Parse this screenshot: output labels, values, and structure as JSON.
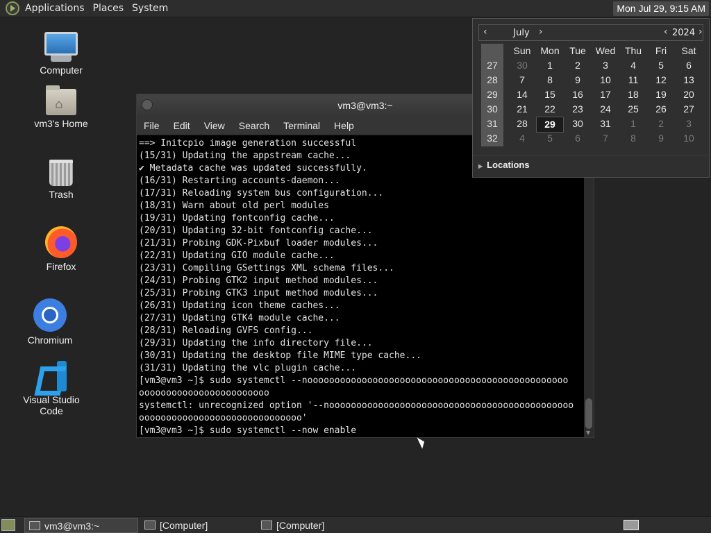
{
  "top_panel": {
    "menus": [
      "Applications",
      "Places",
      "System"
    ],
    "clock": "Mon Jul 29,  9:15 AM"
  },
  "desktop_icons": {
    "computer": "Computer",
    "home": "vm3's Home",
    "trash": "Trash",
    "firefox": "Firefox",
    "chromium": "Chromium",
    "vscode": "Visual Studio Code"
  },
  "terminal": {
    "title": "vm3@vm3:~",
    "menus": [
      "File",
      "Edit",
      "View",
      "Search",
      "Terminal",
      "Help"
    ],
    "lines": [
      "==> Initcpio image generation successful",
      "(15/31) Updating the appstream cache...",
      "✔ Metadata cache was updated successfully.",
      "(16/31) Restarting accounts-daemon...",
      "(17/31) Reloading system bus configuration...",
      "(18/31) Warn about old perl modules",
      "(19/31) Updating fontconfig cache...",
      "(20/31) Updating 32-bit fontconfig cache...",
      "(21/31) Probing GDK-Pixbuf loader modules...",
      "(22/31) Updating GIO module cache...",
      "(23/31) Compiling GSettings XML schema files...",
      "(24/31) Probing GTK2 input method modules...",
      "(25/31) Probing GTK3 input method modules...",
      "(26/31) Updating icon theme caches...",
      "(27/31) Updating GTK4 module cache...",
      "(28/31) Reloading GVFS config...",
      "(29/31) Updating the info directory file...",
      "(30/31) Updating the desktop file MIME type cache...",
      "(31/31) Updating the vlc plugin cache...",
      "[vm3@vm3 ~]$ sudo systemctl --noooooooooooooooooooooooooooooooooooooooooooooooo",
      "oooooooooooooooooooooooo",
      "systemctl: unrecognized option '--nooooooooooooooooooooooooooooooooooooooooooooo",
      "oooooooooooooooooooooooooooooo'",
      "[vm3@vm3 ~]$ sudo systemctl --now enable"
    ]
  },
  "calendar": {
    "month": "July",
    "year": "2024",
    "weekday_headers": [
      "Sun",
      "Mon",
      "Tue",
      "Wed",
      "Thu",
      "Fri",
      "Sat"
    ],
    "weeks": [
      {
        "week": "27",
        "days": [
          "30",
          "1",
          "2",
          "3",
          "4",
          "5",
          "6"
        ]
      },
      {
        "week": "28",
        "days": [
          "7",
          "8",
          "9",
          "10",
          "11",
          "12",
          "13"
        ]
      },
      {
        "week": "29",
        "days": [
          "14",
          "15",
          "16",
          "17",
          "18",
          "19",
          "20"
        ]
      },
      {
        "week": "30",
        "days": [
          "21",
          "22",
          "23",
          "24",
          "25",
          "26",
          "27"
        ]
      },
      {
        "week": "31",
        "days": [
          "28",
          "29",
          "30",
          "31",
          "1",
          "2",
          "3"
        ]
      },
      {
        "week": "32",
        "days": [
          "4",
          "5",
          "6",
          "7",
          "8",
          "9",
          "10"
        ]
      }
    ],
    "today": "29",
    "locations_label": "Locations"
  },
  "bottom_panel": {
    "tasks": [
      "vm3@vm3:~",
      "[Computer]",
      "[Computer]"
    ]
  }
}
